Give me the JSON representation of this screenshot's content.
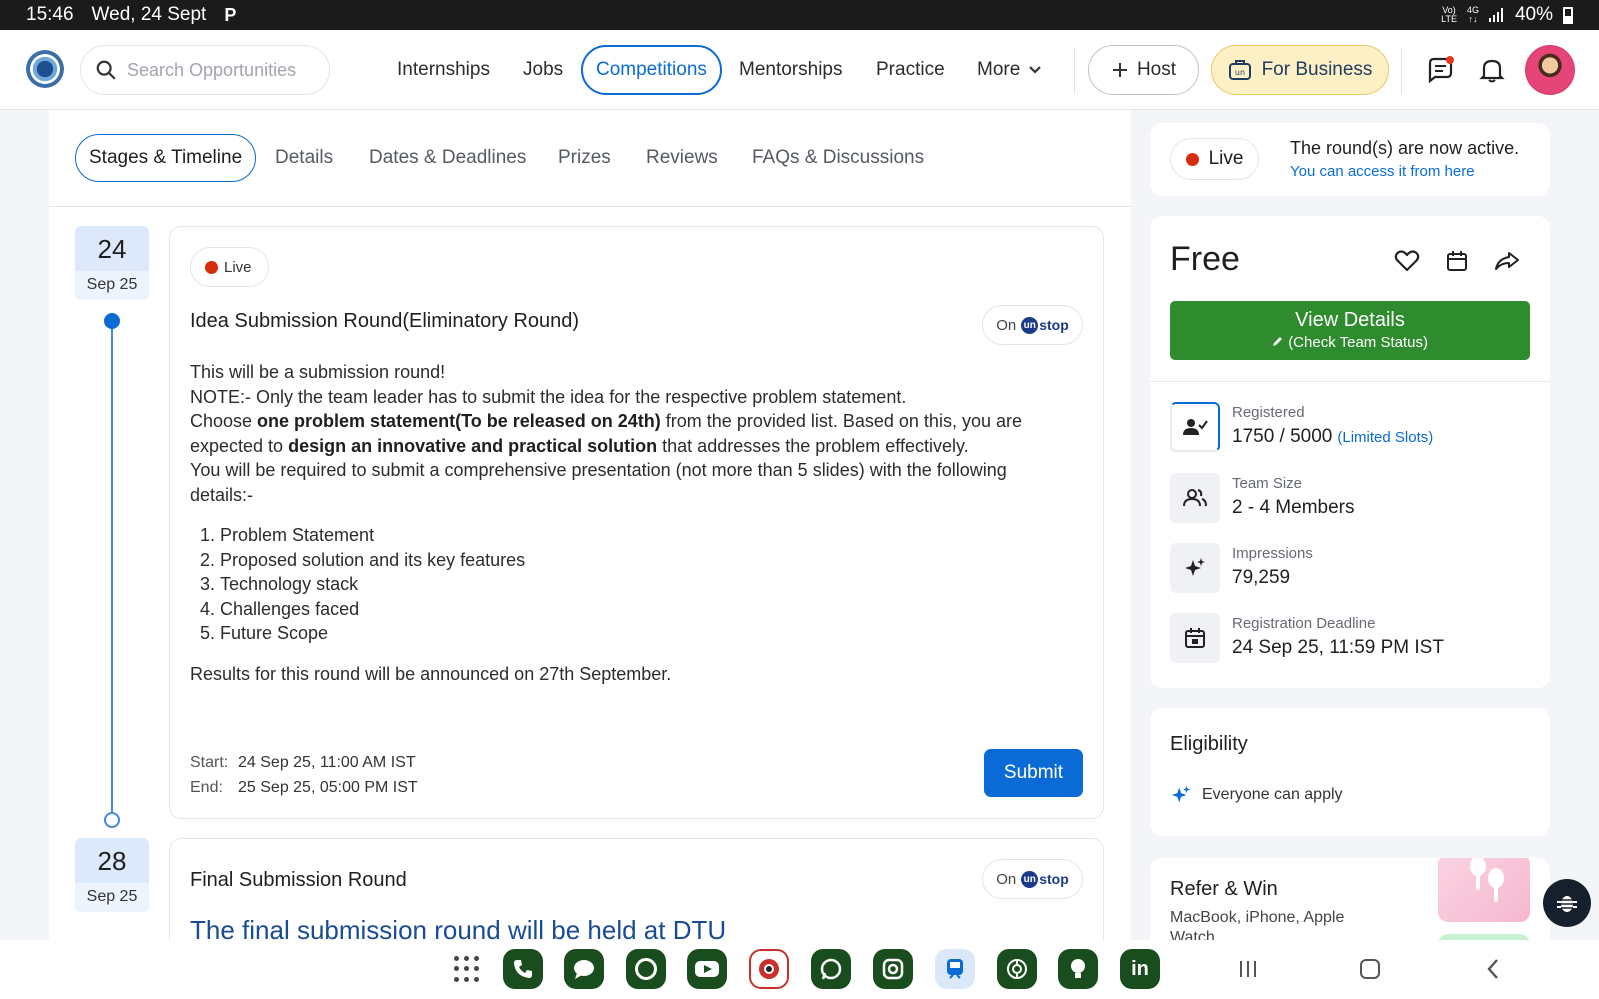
{
  "status_bar": {
    "time": "15:46",
    "date": "Wed, 24 Sept",
    "badge": "P",
    "volte_top": "Vo)",
    "volte_bottom": "LTE",
    "network_top": "4G",
    "network_bottom": "↑↓",
    "battery": "40%"
  },
  "header": {
    "search_placeholder": "Search Opportunities",
    "nav": [
      {
        "label": "Internships"
      },
      {
        "label": "Jobs"
      },
      {
        "label": "Competitions"
      },
      {
        "label": "Mentorships"
      },
      {
        "label": "Practice"
      },
      {
        "label": "More"
      }
    ],
    "host_label": "Host",
    "business_label": "For Business"
  },
  "tabs": [
    {
      "label": "Stages & Timeline"
    },
    {
      "label": "Details"
    },
    {
      "label": "Dates & Deadlines"
    },
    {
      "label": "Prizes"
    },
    {
      "label": "Reviews"
    },
    {
      "label": "FAQs & Discussions"
    }
  ],
  "rounds": [
    {
      "day": "24",
      "month": "Sep 25",
      "live_label": "Live",
      "title": "Idea Submission Round(Eliminatory Round)",
      "on_label": "On",
      "platform_un": "un",
      "platform_stop": "stop",
      "desc": {
        "line1": "This will be a submission round!",
        "line2": "NOTE:- Only the team leader has to submit the idea for the respective problem statement.",
        "line3_pre": "Choose ",
        "line3_bold": "one problem statement(To be released on 24th)",
        "line3_post": "  from the provided list. Based on this, you are expected to ",
        "line3_bold2": "design an innovative and practical solution",
        "line3_end": " that addresses the problem effectively.",
        "line4": "You will be required to submit a comprehensive presentation (not more than 5 slides) with the following details:-",
        "list": [
          "Problem Statement",
          "Proposed solution and its key features",
          "Technology stack",
          "Challenges faced",
          "Future Scope"
        ],
        "results": "Results for this round will be announced on 27th September."
      },
      "start_label": "Start:",
      "start_value": "24 Sep 25, 11:00 AM IST",
      "end_label": "End:",
      "end_value": "25 Sep 25, 05:00 PM IST",
      "submit_label": "Submit"
    },
    {
      "day": "28",
      "month": "Sep 25",
      "title": "Final Submission Round",
      "on_label": "On",
      "platform_un": "un",
      "platform_stop": "stop",
      "desc_line": "The final submission round will be held at DTU"
    }
  ],
  "sidebar": {
    "live_label": "Live",
    "active_text": "The round(s) are now active.",
    "access_link": "You can access it from here",
    "price": "Free",
    "view_details": "View Details",
    "check_team": "(Check Team Status)",
    "stats": [
      {
        "label": "Registered",
        "value": "1750 / 5000",
        "extra": "(Limited Slots)"
      },
      {
        "label": "Team Size",
        "value": "2 - 4 Members"
      },
      {
        "label": "Impressions",
        "value": "79,259"
      },
      {
        "label": "Registration Deadline",
        "value": "24 Sep 25, 11:59 PM IST"
      }
    ],
    "eligibility_title": "Eligibility",
    "eligibility_text": "Everyone can apply",
    "refer_title": "Refer & Win",
    "refer_sub": "MacBook, iPhone, Apple Watch"
  },
  "colors": {
    "accent": "#0a6bd6",
    "live_dot": "#d62d0c",
    "view_button": "#2e8b2e",
    "business_bg": "#fdf0c4"
  },
  "dock": {
    "apps": [
      "phone-icon",
      "messages-icon",
      "chrome-icon",
      "youtube-icon",
      "camera-icon",
      "whatsapp-icon",
      "instagram-icon",
      "transit-icon",
      "openai-icon",
      "bulb-icon",
      "linkedin-icon"
    ],
    "linkedin_text": "in"
  }
}
